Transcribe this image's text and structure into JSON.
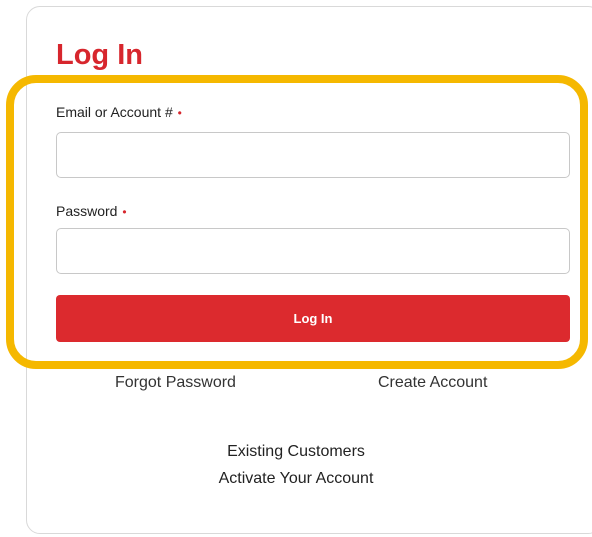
{
  "form": {
    "title": "Log In",
    "email_label": "Email or Account #",
    "password_label": "Password",
    "required_marker": "•",
    "email_value": "",
    "password_value": "",
    "submit_label": "Log In"
  },
  "links": {
    "forgot_password": "Forgot Password",
    "create_account": "Create Account",
    "existing_customers": "Existing Customers",
    "activate_account": "Activate Your Account"
  },
  "colors": {
    "accent": "#dc2a2e",
    "highlight": "#f5b800"
  }
}
